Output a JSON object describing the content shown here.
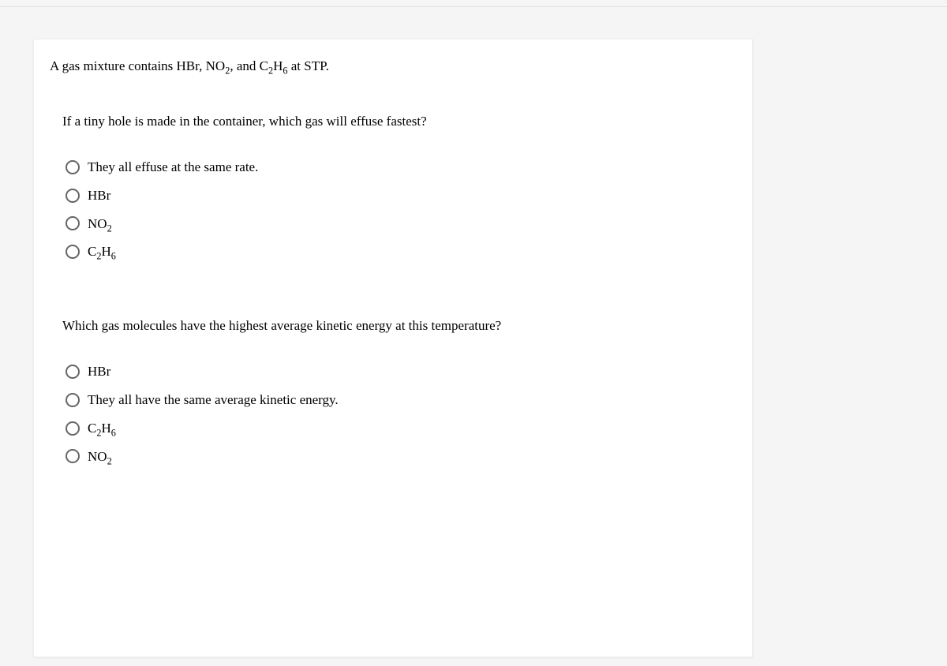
{
  "intro": {
    "prefix": "A gas mixture contains HBr, ",
    "no2_base": "NO",
    "no2_sub": "2",
    "mid": ", and ",
    "c2h6_c": "C",
    "c2h6_s1": "2",
    "c2h6_h": "H",
    "c2h6_s2": "6",
    "suffix": " at STP."
  },
  "q1": {
    "text": "If a tiny hole is made in the container, which gas will effuse fastest?",
    "options": {
      "a": "They all effuse at the same rate.",
      "b": "HBr",
      "c_base": "NO",
      "c_sub": "2",
      "d_c": "C",
      "d_s1": "2",
      "d_h": "H",
      "d_s2": "6"
    }
  },
  "q2": {
    "text": "Which gas molecules have the highest average kinetic energy at this temperature?",
    "options": {
      "a": "HBr",
      "b": "They all have the same average kinetic energy.",
      "c_c": "C",
      "c_s1": "2",
      "c_h": "H",
      "c_s2": "6",
      "d_base": "NO",
      "d_sub": "2"
    }
  }
}
